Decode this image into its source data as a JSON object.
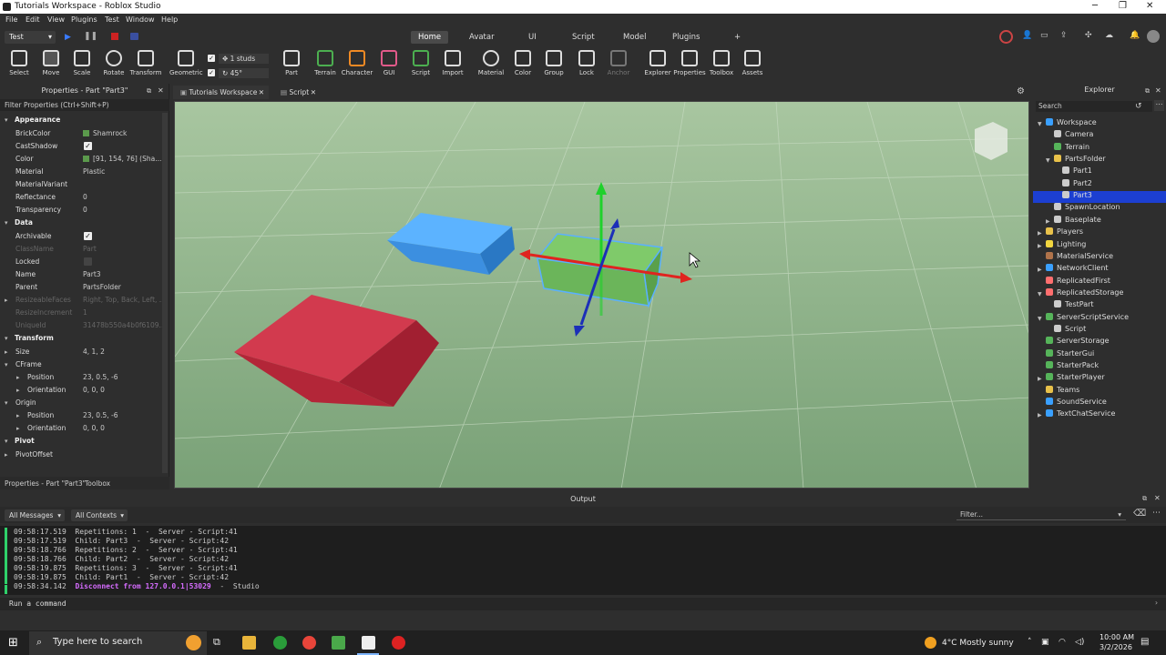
{
  "title_bar": {
    "title": "Tutorials Workspace - Roblox Studio"
  },
  "menu": [
    "File",
    "Edit",
    "View",
    "Plugins",
    "Test",
    "Window",
    "Help"
  ],
  "ribbon": {
    "mode_select": "Test",
    "tabs": [
      "Home",
      "Avatar",
      "UI",
      "Script",
      "Model",
      "Plugins"
    ],
    "active_tab": "Home",
    "tools": [
      {
        "label": "Select",
        "icon": "cursor-icon"
      },
      {
        "label": "Move",
        "icon": "move-arrows-icon"
      },
      {
        "label": "Scale",
        "icon": "scale-icon"
      },
      {
        "label": "Rotate",
        "icon": "rotate-icon"
      },
      {
        "label": "Transform",
        "icon": "transform-icon"
      },
      {
        "label": "Geometric",
        "icon": "geometric-icon"
      },
      {
        "label": "Part",
        "icon": "cube-icon"
      },
      {
        "label": "Terrain",
        "icon": "terrain-icon"
      },
      {
        "label": "Character",
        "icon": "character-icon"
      },
      {
        "label": "GUI",
        "icon": "gui-icon"
      },
      {
        "label": "Script",
        "icon": "script-icon"
      },
      {
        "label": "Import",
        "icon": "import-icon"
      },
      {
        "label": "Material",
        "icon": "material-icon"
      },
      {
        "label": "Color",
        "icon": "color-icon"
      },
      {
        "label": "Group",
        "icon": "group-icon"
      },
      {
        "label": "Lock",
        "icon": "lock-icon"
      },
      {
        "label": "Anchor",
        "icon": "anchor-icon"
      },
      {
        "label": "Explorer",
        "icon": "explorer-icon"
      },
      {
        "label": "Properties",
        "icon": "properties-icon"
      },
      {
        "label": "Toolbox",
        "icon": "toolbox-icon"
      },
      {
        "label": "Assets",
        "icon": "assets-icon"
      }
    ],
    "snap_move": "1 studs",
    "snap_rotate": "45°"
  },
  "properties": {
    "header": "Properties - Part \"Part3\"",
    "filter_placeholder": "Filter Properties (Ctrl+Shift+P)",
    "rows": [
      {
        "kind": "section",
        "name": "Appearance"
      },
      {
        "name": "BrickColor",
        "value": "Shamrock",
        "swatch": "#5b9a4c"
      },
      {
        "name": "CastShadow",
        "check": true
      },
      {
        "name": "Color",
        "value": "[91, 154, 76] (Sha...",
        "swatch": "#5b9a4c"
      },
      {
        "name": "Material",
        "value": "Plastic"
      },
      {
        "name": "MaterialVariant",
        "value": ""
      },
      {
        "name": "Reflectance",
        "value": "0"
      },
      {
        "name": "Transparency",
        "value": "0"
      },
      {
        "kind": "section",
        "name": "Data"
      },
      {
        "name": "Archivable",
        "check": true
      },
      {
        "name": "ClassName",
        "value": "Part",
        "dim": true
      },
      {
        "name": "Locked",
        "check": false
      },
      {
        "name": "Name",
        "value": "Part3"
      },
      {
        "name": "Parent",
        "value": "PartsFolder"
      },
      {
        "name": "ResizeableFaces",
        "value": "Right, Top, Back, Left, ...",
        "dim": true,
        "arrow": true
      },
      {
        "name": "ResizeIncrement",
        "value": "1",
        "dim": true
      },
      {
        "name": "UniqueId",
        "value": "31478b550a4b0f6109...",
        "dim": true
      },
      {
        "kind": "section",
        "name": "Transform"
      },
      {
        "name": "Size",
        "value": "4, 1, 2",
        "arrow": true
      },
      {
        "name": "CFrame",
        "value": "",
        "arrow": true,
        "open": true
      },
      {
        "name": "Position",
        "value": "23, 0.5, -6",
        "arrow": true,
        "indent": true
      },
      {
        "name": "Orientation",
        "value": "0, 0, 0",
        "arrow": true,
        "indent": true
      },
      {
        "name": "Origin",
        "value": "",
        "arrow": true,
        "open": true
      },
      {
        "name": "Position",
        "value": "23, 0.5, -6",
        "arrow": true,
        "indent": true
      },
      {
        "name": "Orientation",
        "value": "0, 0, 0",
        "arrow": true,
        "indent": true
      },
      {
        "kind": "section",
        "name": "Pivot"
      },
      {
        "name": "PivotOffset",
        "value": "",
        "arrow": true
      }
    ],
    "footer_tabs": [
      "Properties - Part \"Part3\"",
      "Toolbox"
    ]
  },
  "doc_tabs": [
    {
      "label": "Tutorials Workspace",
      "active": true
    },
    {
      "label": "Script",
      "active": false
    }
  ],
  "explorer": {
    "title": "Explorer",
    "search_placeholder": "Search",
    "items": [
      {
        "label": "Workspace",
        "depth": 0,
        "open": true,
        "color": "#3aa0ff"
      },
      {
        "label": "Camera",
        "depth": 1,
        "color": "#cccccc"
      },
      {
        "label": "Terrain",
        "depth": 1,
        "color": "#56b45a"
      },
      {
        "label": "PartsFolder",
        "depth": 1,
        "open": true,
        "color": "#e8c14a"
      },
      {
        "label": "Part1",
        "depth": 2,
        "color": "#cccccc"
      },
      {
        "label": "Part2",
        "depth": 2,
        "color": "#cccccc"
      },
      {
        "label": "Part3",
        "depth": 2,
        "color": "#cccccc",
        "selected": true
      },
      {
        "label": "SpawnLocation",
        "depth": 1,
        "color": "#cccccc"
      },
      {
        "label": "Baseplate",
        "depth": 1,
        "color": "#cccccc",
        "closed": true
      },
      {
        "label": "Players",
        "depth": 0,
        "color": "#e8c14a",
        "closed": true
      },
      {
        "label": "Lighting",
        "depth": 0,
        "color": "#f2d640",
        "closed": true
      },
      {
        "label": "MaterialService",
        "depth": 0,
        "color": "#b0734a"
      },
      {
        "label": "NetworkClient",
        "depth": 0,
        "color": "#3aa0ff",
        "closed": true
      },
      {
        "label": "ReplicatedFirst",
        "depth": 0,
        "color": "#ff6f6f"
      },
      {
        "label": "ReplicatedStorage",
        "depth": 0,
        "color": "#ff6f6f",
        "open": true
      },
      {
        "label": "TestPart",
        "depth": 1,
        "color": "#cccccc"
      },
      {
        "label": "ServerScriptService",
        "depth": 0,
        "color": "#56b45a",
        "open": true
      },
      {
        "label": "Script",
        "depth": 1,
        "color": "#cccccc"
      },
      {
        "label": "ServerStorage",
        "depth": 0,
        "color": "#56b45a"
      },
      {
        "label": "StarterGui",
        "depth": 0,
        "color": "#56b45a"
      },
      {
        "label": "StarterPack",
        "depth": 0,
        "color": "#56b45a"
      },
      {
        "label": "StarterPlayer",
        "depth": 0,
        "color": "#56b45a",
        "closed": true
      },
      {
        "label": "Teams",
        "depth": 0,
        "color": "#e8c14a"
      },
      {
        "label": "SoundService",
        "depth": 0,
        "color": "#3aa0ff"
      },
      {
        "label": "TextChatService",
        "depth": 0,
        "color": "#3aa0ff",
        "closed": true
      }
    ]
  },
  "output": {
    "title": "Output",
    "filter_messages": "All Messages",
    "filter_contexts": "All Contexts",
    "filter_placeholder": "Filter...",
    "lines": [
      {
        "text": "09:58:17.519  Repetitions: 1  -  Server - Script:41"
      },
      {
        "text": "09:58:17.519  Child: Part3  -  Server - Script:42"
      },
      {
        "text": "09:58:18.766  Repetitions: 2  -  Server - Script:41"
      },
      {
        "text": "09:58:18.766  Child: Part2  -  Server - Script:42"
      },
      {
        "text": "09:58:19.875  Repetitions: 3  -  Server - Script:41"
      },
      {
        "text": "09:58:19.875  Child: Part1  -  Server - Script:42"
      },
      {
        "time": "09:58:34.142",
        "highlight": "Disconnect from 127.0.0.1|53029",
        "rest": "  -  Studio"
      }
    ],
    "command_placeholder": "Run a command"
  },
  "taskbar": {
    "search_placeholder": "Type here to search",
    "weather": "4°C  Mostly sunny",
    "time": "10:00 AM",
    "date": "3/2/2026"
  },
  "colors": {
    "accent": "#1c3fd1",
    "green_part": "#5b9a4c",
    "blue_part": "#3a8fd8",
    "red_part": "#c4283c"
  }
}
